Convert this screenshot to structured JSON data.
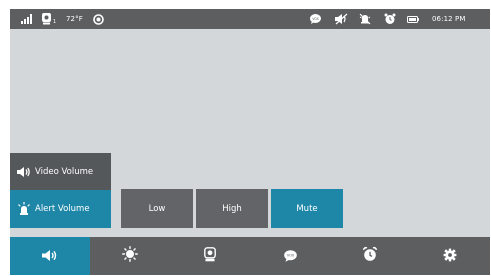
{
  "status_bar": {
    "icons": [
      "signal-icon",
      "camera-icon",
      "eye-icon",
      "vox-icon",
      "speaker-muted-icon",
      "alert-muted-icon",
      "alarm-icon",
      "battery-icon"
    ],
    "camera_index": "1",
    "temperature": "72°F",
    "time": "06:12 PM"
  },
  "volume_menu": {
    "video_volume_label": "Video Volume",
    "alert_volume_label": "Alert Volume",
    "selected": "Alert Volume"
  },
  "alert_options": {
    "items": [
      "Low",
      "High",
      "Mute"
    ],
    "selected": "Mute"
  },
  "tab_bar": {
    "tabs": [
      "volume-icon",
      "brightness-icon",
      "camera-icon",
      "vox-icon",
      "alarm-clock-icon",
      "settings-icon"
    ],
    "active_tab": "volume-icon"
  },
  "colors": {
    "accent": "#1e87a8",
    "bar": "#5c5e60",
    "button": "#626467",
    "screen": "#d4d7da"
  }
}
